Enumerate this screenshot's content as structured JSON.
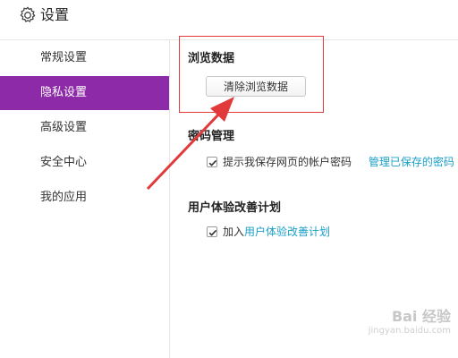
{
  "header": {
    "title": "设置",
    "icon": "gear-icon"
  },
  "sidebar": {
    "items": [
      {
        "label": "常规设置",
        "active": false
      },
      {
        "label": "隐私设置",
        "active": true
      },
      {
        "label": "高级设置",
        "active": false
      },
      {
        "label": "安全中心",
        "active": false
      },
      {
        "label": "我的应用",
        "active": false
      }
    ]
  },
  "browsing": {
    "title": "浏览数据",
    "clear_button": "清除浏览数据"
  },
  "password": {
    "title": "密码管理",
    "remember_checked": true,
    "remember_label": "提示我保存网页的帐户密码",
    "manage_link": "管理已保存的密码"
  },
  "ux": {
    "title": "用户体验改善计划",
    "join_checked": true,
    "join_prefix": "加入",
    "join_link": "用户体验改善计划"
  },
  "watermark": {
    "brand": "Bai 经验",
    "url": "jingyan.baidu.com"
  },
  "colors": {
    "active_nav": "#8d2aa7",
    "link": "#1a9fc7",
    "annotation": "#e23a3a"
  }
}
